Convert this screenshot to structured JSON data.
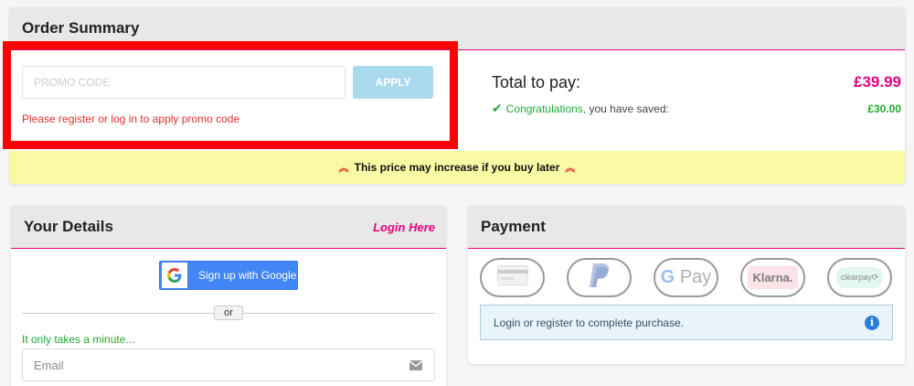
{
  "order_summary": {
    "title": "Order Summary",
    "promo_placeholder": "PROMO CODE",
    "apply_label": "APPLY",
    "promo_error": "Please register or log in to apply promo code",
    "total_label": "Total to pay:",
    "total_value": "£39.99",
    "congrats": "Congratulations,",
    "saved_text": " you have saved:",
    "saved_amount": "£30.00",
    "warning": "This price may increase if you buy later"
  },
  "your_details": {
    "title": "Your Details",
    "login_link": "Login Here",
    "google_button": "Sign up with Google",
    "or_label": "or",
    "minute_text": "It only takes a minute...",
    "email_placeholder": "Email"
  },
  "payment": {
    "title": "Payment",
    "methods": [
      {
        "name": "card",
        "icon": "credit-card-icon"
      },
      {
        "name": "PayPal",
        "icon": "paypal-icon"
      },
      {
        "name": "G Pay",
        "icon": "google-pay-icon"
      },
      {
        "name": "Klarna.",
        "icon": "klarna-icon"
      },
      {
        "name": "clearpay",
        "icon": "clearpay-icon"
      }
    ],
    "info": "Login or register to complete purchase."
  },
  "colors": {
    "brand_pink": "#e6007e",
    "success_green": "#22a832",
    "error_red": "#e0322c",
    "warning_bg": "#fafaa5",
    "apply_btn": "#a9d9ec",
    "google_blue": "#4285f4",
    "highlight": "#ff0000"
  }
}
